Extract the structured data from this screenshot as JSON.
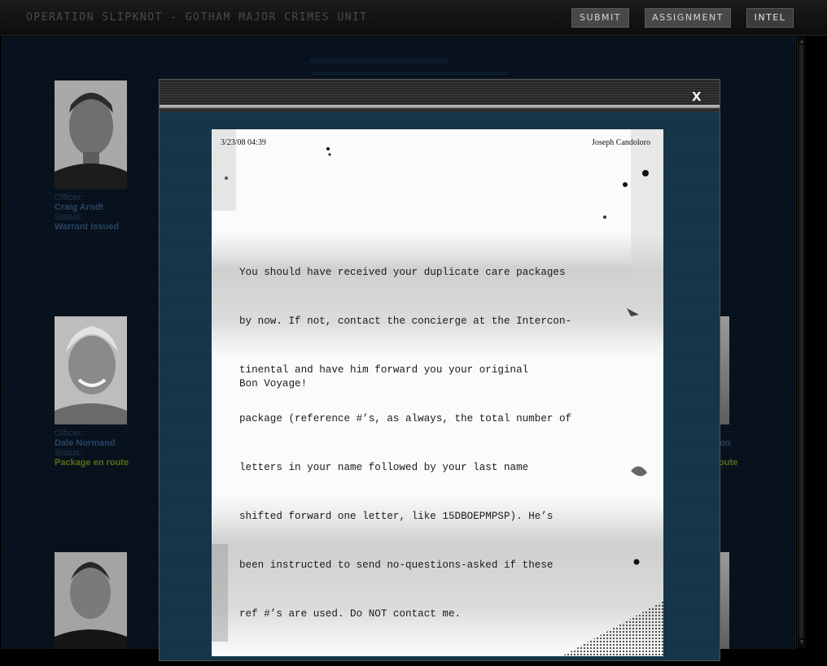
{
  "header": {
    "title": "OPERATION SLIPKNOT - GOTHAM MAJOR CRIMES UNIT",
    "nav": [
      "SUBMIT",
      "ASSIGNMENT",
      "INTEL"
    ]
  },
  "cards": [
    {
      "officer_label": "Officer:",
      "officer": "Craig Arndt",
      "status_label": "Status:",
      "status": "Warrant Issued"
    },
    {
      "officer_label": "Officer:",
      "officer": "Dale Normand",
      "status_label": "Status:",
      "status": "Package en route"
    }
  ],
  "right_card": {
    "officer_fragment": "on",
    "status_fragment": "oute"
  },
  "modal": {
    "close_label": "X",
    "letter": {
      "timestamp": "3/23/08 04:39",
      "author": "Joseph Candoloro",
      "lines": [
        "You should have received your duplicate care packages",
        "by now. If not, contact the concierge at the Intercon-",
        "tinental and have him forward you your original",
        "package (reference #’s, as always, the total number of",
        "letters in your name followed by your last name",
        "shifted forward one letter, like 15DBOEPMPSP). He’s",
        "been instructed to send no-questions-asked if these",
        "ref #’s are used. Do NOT contact me."
      ],
      "signoff": "Bon Voyage!"
    }
  },
  "colors": {
    "page_bg": "#06101c",
    "modal_bg": "#17394e",
    "status_package": "#5c6a16"
  }
}
